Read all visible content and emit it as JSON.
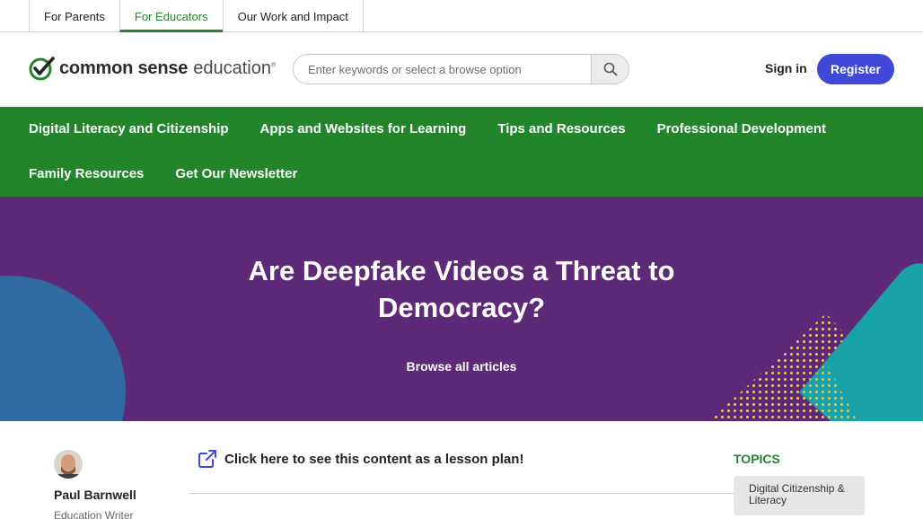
{
  "audience_tabs": [
    {
      "label": "For Parents",
      "active": false
    },
    {
      "label": "For Educators",
      "active": true
    },
    {
      "label": "Our Work and Impact",
      "active": false
    }
  ],
  "header": {
    "logo": {
      "bold": "common sense",
      "light": "education",
      "reg": "®",
      "icon": "checkmark-logo-icon"
    },
    "search": {
      "placeholder": "Enter keywords or select a browse option",
      "value": "",
      "icon": "search-icon"
    },
    "signin_label": "Sign in",
    "register_label": "Register"
  },
  "nav": {
    "row1": [
      "Digital Literacy and Citizenship",
      "Apps and Websites for Learning",
      "Tips and Resources",
      "Professional Development"
    ],
    "row2": [
      "Family Resources",
      "Get Our Newsletter"
    ]
  },
  "hero": {
    "title": "Are Deepfake Videos a Threat to Democracy?",
    "browse_link": "Browse all articles"
  },
  "author": {
    "name": "Paul Barnwell",
    "role": "Education Writer"
  },
  "lesson_link": {
    "label": "Click here to see this content as a lesson plan!",
    "icon": "external-link-icon"
  },
  "topics": {
    "heading": "TOPICS",
    "items": [
      "Digital Citizenship & Literacy"
    ]
  },
  "colors": {
    "brand_green": "#23852b",
    "hero_purple": "#5e2a78",
    "register_blue": "#3f48d9",
    "accent_teal": "#19a3a8",
    "accent_yellow": "#f5c84c"
  }
}
